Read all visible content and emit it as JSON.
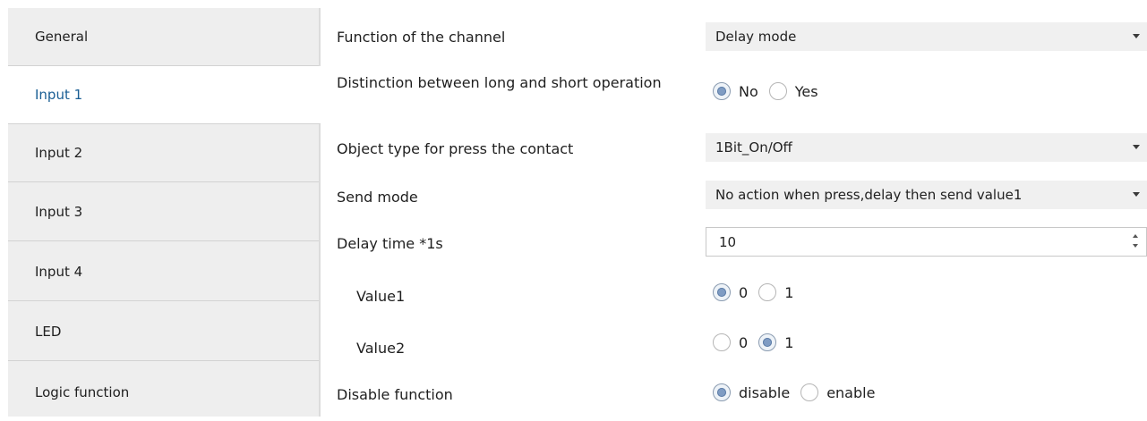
{
  "sidebar": {
    "items": [
      {
        "label": "General"
      },
      {
        "label": "Input 1",
        "active": true
      },
      {
        "label": "Input 2"
      },
      {
        "label": "Input 3"
      },
      {
        "label": "Input 4"
      },
      {
        "label": "LED"
      },
      {
        "label": "Logic function"
      }
    ]
  },
  "params": {
    "function_channel": {
      "label": "Function of the channel",
      "value": "Delay mode"
    },
    "distinction": {
      "label": "Distinction between long and short operation",
      "options": [
        "No",
        "Yes"
      ],
      "selected": "No"
    },
    "object_type": {
      "label": "Object type for press the contact",
      "value": "1Bit_On/Off"
    },
    "send_mode": {
      "label": "Send mode",
      "value": "No action when press,delay then send value1"
    },
    "delay_time": {
      "label": "Delay time *1s",
      "value": "10"
    },
    "value1": {
      "label": "Value1",
      "options": [
        "0",
        "1"
      ],
      "selected": "0"
    },
    "value2": {
      "label": "Value2",
      "options": [
        "0",
        "1"
      ],
      "selected": "1"
    },
    "disable_function": {
      "label": "Disable function",
      "options": [
        "disable",
        "enable"
      ],
      "selected": "disable"
    }
  },
  "icons": {
    "dropdown": "chevron-down-icon",
    "spinner": "spinner-arrows-icon",
    "radio": "radio-button-icon"
  },
  "colors": {
    "active_tab_text": "#1a5e94",
    "sidebar_bg": "#eeeeee",
    "select_bg": "#f0f0f0",
    "radio_selected": "#7f9cc3"
  }
}
